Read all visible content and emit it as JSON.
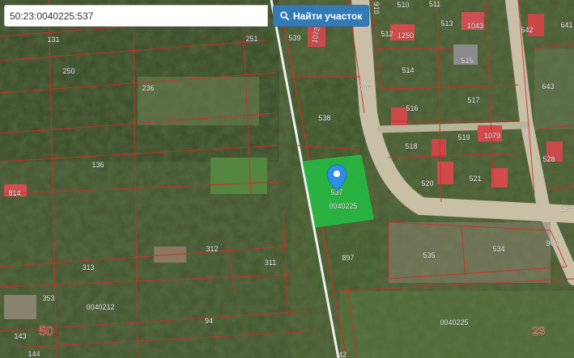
{
  "search": {
    "value": "50:23:0040225:537",
    "button_label": "Найти участок",
    "button_icon": "search-icon"
  },
  "map": {
    "selected_parcel": {
      "number": "537",
      "cadastral_block": "0040225",
      "color": "#22c042"
    },
    "parcel_line_color": "#d42a2a",
    "marker_color": "#2f8fe8",
    "labels": {
      "l131": "131",
      "l251": "251",
      "l250": "250",
      "l236": "236",
      "l136": "136",
      "l814": "814",
      "l312": "312",
      "l313": "313",
      "l311": "311",
      "l353": "353",
      "l0040212": "0040212",
      "l50": "50",
      "l143": "143",
      "l94": "94",
      "l144": "144",
      "l539": "539",
      "l1072": "1072",
      "l910": "910",
      "l510": "510",
      "l511": "511",
      "l512": "512",
      "l1250": "1250",
      "l513": "513",
      "l1043": "1043",
      "l514": "514",
      "l515": "515",
      "l642": "642",
      "l641": "641",
      "l643": "643",
      "l906a": "906",
      "l538": "538",
      "l516": "516",
      "l517": "517",
      "l518": "518",
      "l519": "519",
      "l1079": "1079",
      "l528": "528",
      "l520": "520",
      "l521": "521",
      "l174": "174",
      "l906b": "906",
      "l535": "535",
      "l534": "534",
      "l897": "897",
      "l0040225": "0040225",
      "l23": "23",
      "l42": "42"
    }
  }
}
